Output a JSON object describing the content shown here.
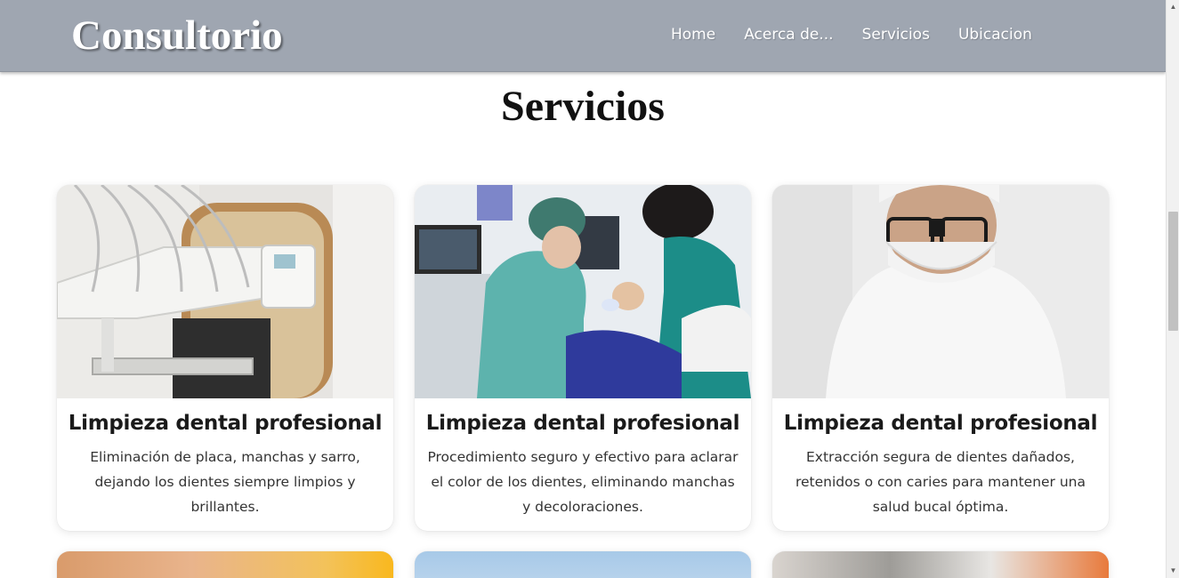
{
  "navbar": {
    "brand": "Consultorio",
    "links": [
      "Home",
      "Acerca de...",
      "Servicios",
      "Ubicacion"
    ]
  },
  "section": {
    "title": "Servicios"
  },
  "cards": [
    {
      "title": "Limpieza dental profesional",
      "description": "Eliminación de placa, manchas y sarro, dejando los dientes siempre limpios y brillantes.",
      "image_icon": "dental-equipment-image"
    },
    {
      "title": "Limpieza dental profesional",
      "description": "Procedimiento seguro y efectivo para aclarar el color de los dientes, eliminando manchas y decoloraciones.",
      "image_icon": "dental-procedure-image"
    },
    {
      "title": "Limpieza dental profesional",
      "description": "Extracción segura de dientes dañados, retenidos o con caries para mantener una salud bucal óptima.",
      "image_icon": "dentist-portrait-image"
    }
  ],
  "colors": {
    "navbar": "#9fa6b1",
    "title": "#111111",
    "card_text": "#333333"
  }
}
